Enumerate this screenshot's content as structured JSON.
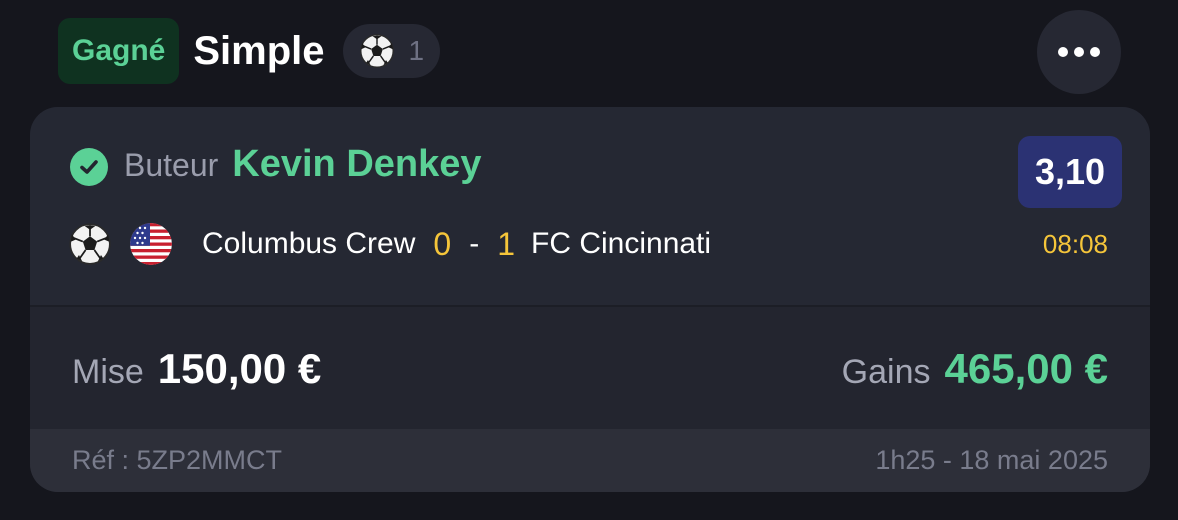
{
  "header": {
    "status_badge": "Gagné",
    "bet_type": "Simple",
    "sport_icon": "soccer-ball-icon",
    "selection_count": "1",
    "more_icon": "more-horizontal-icon"
  },
  "selection": {
    "status_icon": "check-circle-icon",
    "market": "Buteur",
    "name": "Kevin Denkey",
    "odds": "3,10",
    "sport_icon": "soccer-ball-icon",
    "country_flag_icon": "usa-flag-icon",
    "home_team": "Columbus Crew",
    "home_score": "0",
    "score_separator": "-",
    "away_score": "1",
    "away_team": "FC Cincinnati",
    "match_time": "08:08"
  },
  "summary": {
    "stake_label": "Mise",
    "stake_value": "150,00 €",
    "gains_label": "Gains",
    "gains_value": "465,00 €"
  },
  "footer": {
    "reference": "Réf : 5ZP2MMCT",
    "datetime": "1h25 - 18 mai 2025"
  },
  "colors": {
    "background": "#15161d",
    "card": "#23252f",
    "win_green": "#5bd196",
    "score_yellow": "#f5c53a",
    "odds_blue": "#2b3273"
  }
}
